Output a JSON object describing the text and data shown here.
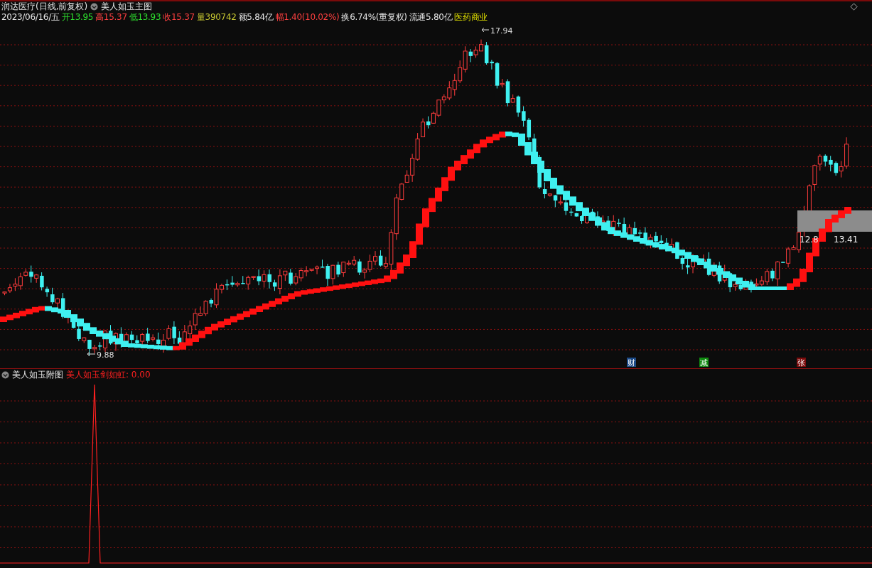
{
  "title_bar": {
    "stock": "润达医疗(日线,前复权)",
    "indicator": "美人如玉主图"
  },
  "quote": [
    {
      "text": "2023/06/16/五",
      "color": "#e6e6e6"
    },
    {
      "text": "开13.95",
      "color": "#2ee02e"
    },
    {
      "text": "高15.37",
      "color": "#ff4040"
    },
    {
      "text": "低13.93",
      "color": "#2ee02e"
    },
    {
      "text": "收15.37",
      "color": "#ff4040"
    },
    {
      "text": "量390742",
      "color": "#c8c832"
    },
    {
      "text": "额5.84亿",
      "color": "#e6e6e6"
    },
    {
      "text": "幅1.40(10.02%)",
      "color": "#ff4040"
    },
    {
      "text": "换6.74%(重复权)",
      "color": "#e6e6e6"
    },
    {
      "text": "流通5.80亿",
      "color": "#e6e6e6"
    },
    {
      "text": "医药商业",
      "color": "#e0e000"
    }
  ],
  "main_chart": {
    "high_label": "17.94",
    "low_label": "9.88",
    "range_labels": [
      "12.8",
      "13.41"
    ],
    "event_markers": [
      {
        "text": "财",
        "color": "#1c4a86"
      },
      {
        "text": "减",
        "color": "#108a10"
      },
      {
        "text": "张",
        "color": "#7a0a0a"
      }
    ]
  },
  "sub_chart": {
    "title": "美人如玉附图",
    "indicator": "美人如玉剑如虹: 0.00"
  }
}
